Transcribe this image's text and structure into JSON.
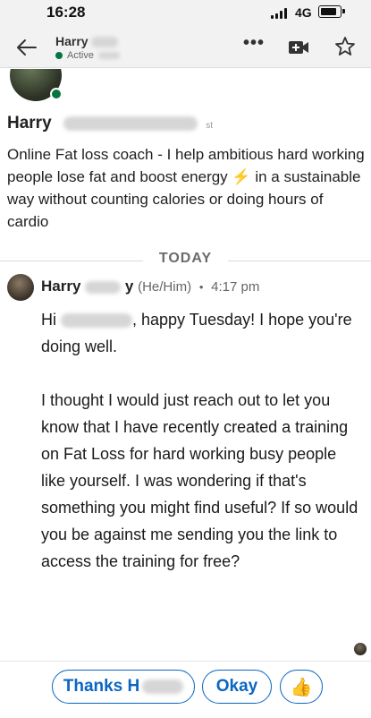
{
  "status_bar": {
    "time": "16:28",
    "network": "4G"
  },
  "header": {
    "name": "Harry",
    "status": "Active"
  },
  "profile": {
    "name": "Harry",
    "name_tail": "st",
    "headline_part1": "Online Fat loss coach - I help ambitious hard working people lose fat and boost energy",
    "headline_part2": "in a sustainable way without counting calories or doing hours of cardio"
  },
  "divider_label": "TODAY",
  "message": {
    "sender": "Harry",
    "sender_tail": "y",
    "pronouns": "(He/Him)",
    "separator": "•",
    "time": "4:17 pm",
    "greeting_start": "Hi",
    "greeting_end": ", happy Tuesday! I hope you're doing well.",
    "paragraph": "I thought I would just reach out to let you know that I have recently created a training on Fat Loss for hard working busy people like yourself. I was wondering if that's something you might find useful? If so would you be against me sending you the link to access the training for free?"
  },
  "quick_replies": [
    "Thanks H",
    "Okay"
  ],
  "colors": {
    "accent": "#0a66c2",
    "online": "#057642"
  }
}
